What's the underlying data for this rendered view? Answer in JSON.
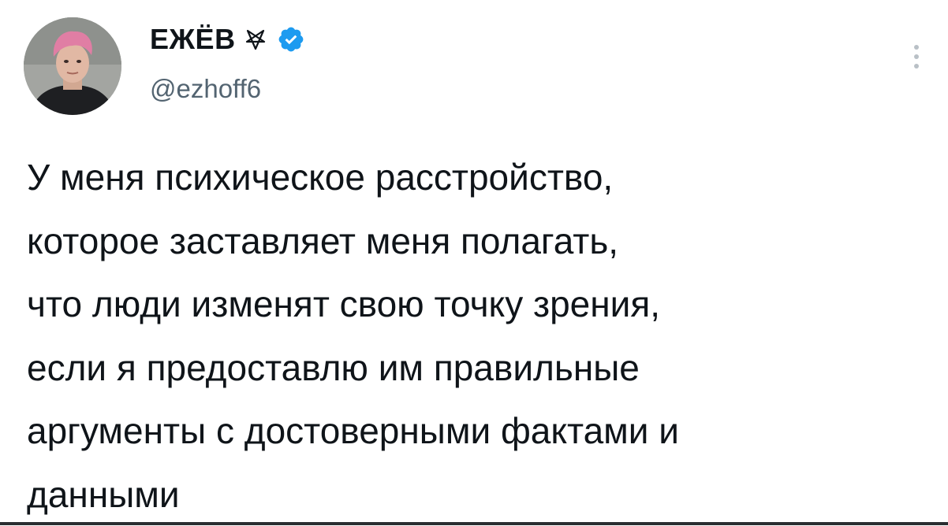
{
  "author": {
    "display_name": "ЕЖЁВ",
    "name_emoji": "⛧",
    "handle": "@ezhoff6",
    "verified": true,
    "verified_color": "#1d9bf0"
  },
  "tweet": {
    "lines": [
      "У меня психическое расстройство,",
      "которое заставляет меня полагать,",
      "что люди изменят свою точку зрения,",
      "если я предоставлю им правильные",
      "аргументы с достоверными фактами и",
      "данными"
    ]
  },
  "icons": {
    "verified": "verified-badge-icon",
    "more": "more-options-icon",
    "name_emoji": "pentagram-icon"
  },
  "colors": {
    "text": "#0f1419",
    "secondary": "#536471",
    "background": "#ffffff"
  }
}
